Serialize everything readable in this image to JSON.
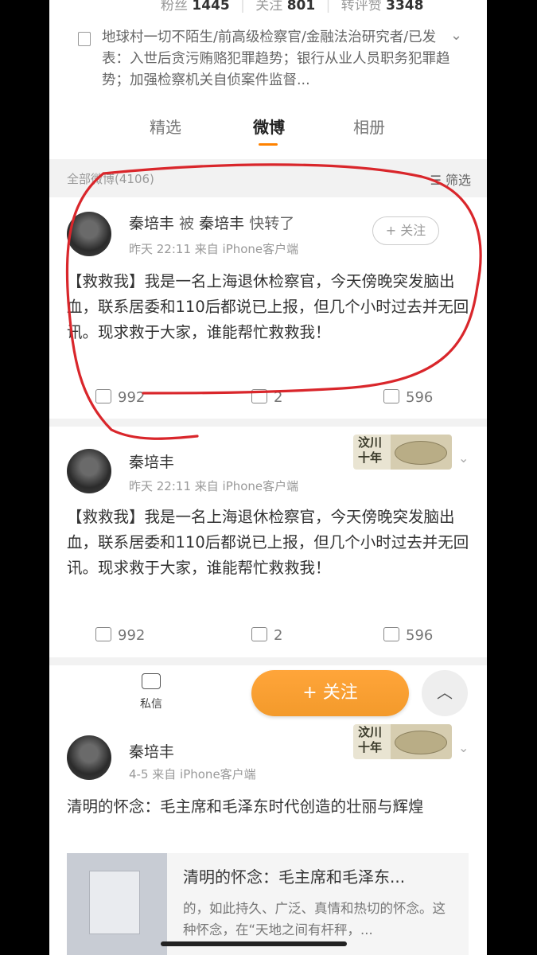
{
  "header": {
    "fans_label": "粉丝",
    "fans_count": "1445",
    "follow_label": "关注",
    "follow_count": "801",
    "repost_label": "转评赞",
    "repost_count": "3348",
    "bio": "地球村一切不陌生/前高级检察官/金融法治研究者/已发表：入世后贪污贿赂犯罪趋势；银行从业人员职务犯罪趋势；加强检察机关自侦案件监督..."
  },
  "tabs": [
    {
      "label": "精选"
    },
    {
      "label": "微博"
    },
    {
      "label": "相册"
    }
  ],
  "filter_bar": {
    "all_label": "全部微博(4106)",
    "filter_label": "筛选"
  },
  "posts": [
    {
      "user_line": "秦培丰",
      "repost_word": "被",
      "repost_user": "秦培丰",
      "repost_action": "快转了",
      "meta": "昨天 22:11   来自 iPhone客户端",
      "follow_label": "+ 关注",
      "text": "【救救我】我是一名上海退休检察官，今天傍晚突发脑出血，联系居委和110后都说已上报，但几个小时过去并无回讯。现求救于大家，谁能帮忙救救我！",
      "reposts": "992",
      "comments": "2",
      "likes": "596"
    },
    {
      "user_line": "秦培丰",
      "meta": "昨天 22:11   来自 iPhone客户端",
      "badge": "汶川\n十年",
      "text": "【救救我】我是一名上海退休检察官，今天傍晚突发脑出血，联系居委和110后都说已上报，但几个小时过去并无回讯。现求救于大家，谁能帮忙救救我！",
      "reposts": "992",
      "comments": "2",
      "likes": "596"
    },
    {
      "user_line": "秦培丰",
      "meta": "4-5   来自 iPhone客户端",
      "badge": "汶川\n十年",
      "text": "清明的怀念：毛主席和毛泽东时代创造的壮丽与辉煌",
      "preview_title": "清明的怀念：毛主席和毛泽东...",
      "preview_body": "的，如此持久、广泛、真情和热切的怀念。这种怀念，在“天地之间有杆秤，..."
    }
  ],
  "floating": {
    "message_label": "私信",
    "follow_label": "+ 关注"
  },
  "colors": {
    "accent": "#ff8200",
    "follow_button": "#f39a2b",
    "annotation": "#d9262b"
  }
}
